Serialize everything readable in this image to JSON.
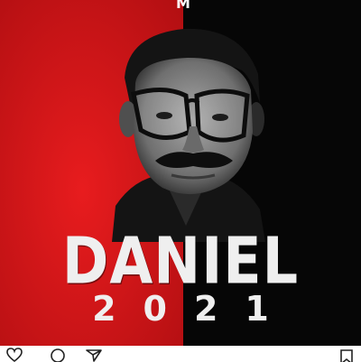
{
  "post": {
    "top_letter": "M",
    "name": "DANIEL",
    "year": "2021",
    "colors": {
      "left": "#e3181b",
      "right": "#050505",
      "text": "#efefef"
    }
  },
  "actions": {
    "icons": [
      "heart-icon",
      "comment-icon",
      "share-icon",
      "bookmark-icon"
    ]
  }
}
